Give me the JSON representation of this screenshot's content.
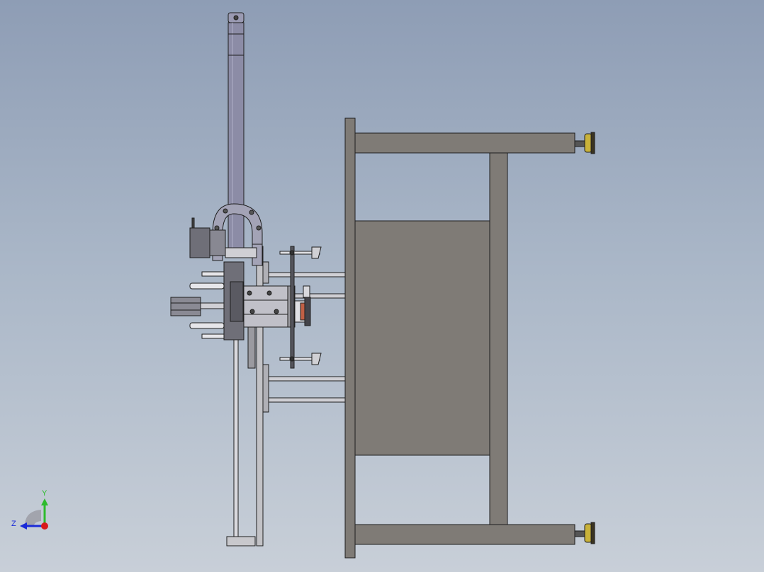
{
  "view": {
    "background_top": "#8e9db5",
    "background_bottom": "#c8cfd8",
    "frame_color": "#7f7b76",
    "metal_color": "#b8b8c2",
    "cylinder_color": "#8c8ca6",
    "edge_color": "#1e1e1e"
  },
  "triad": {
    "y_label": "Y",
    "z_label": "Z",
    "y_color": "#2dbb2d",
    "z_color": "#1a2ad8",
    "x_color": "#d81a1a"
  }
}
